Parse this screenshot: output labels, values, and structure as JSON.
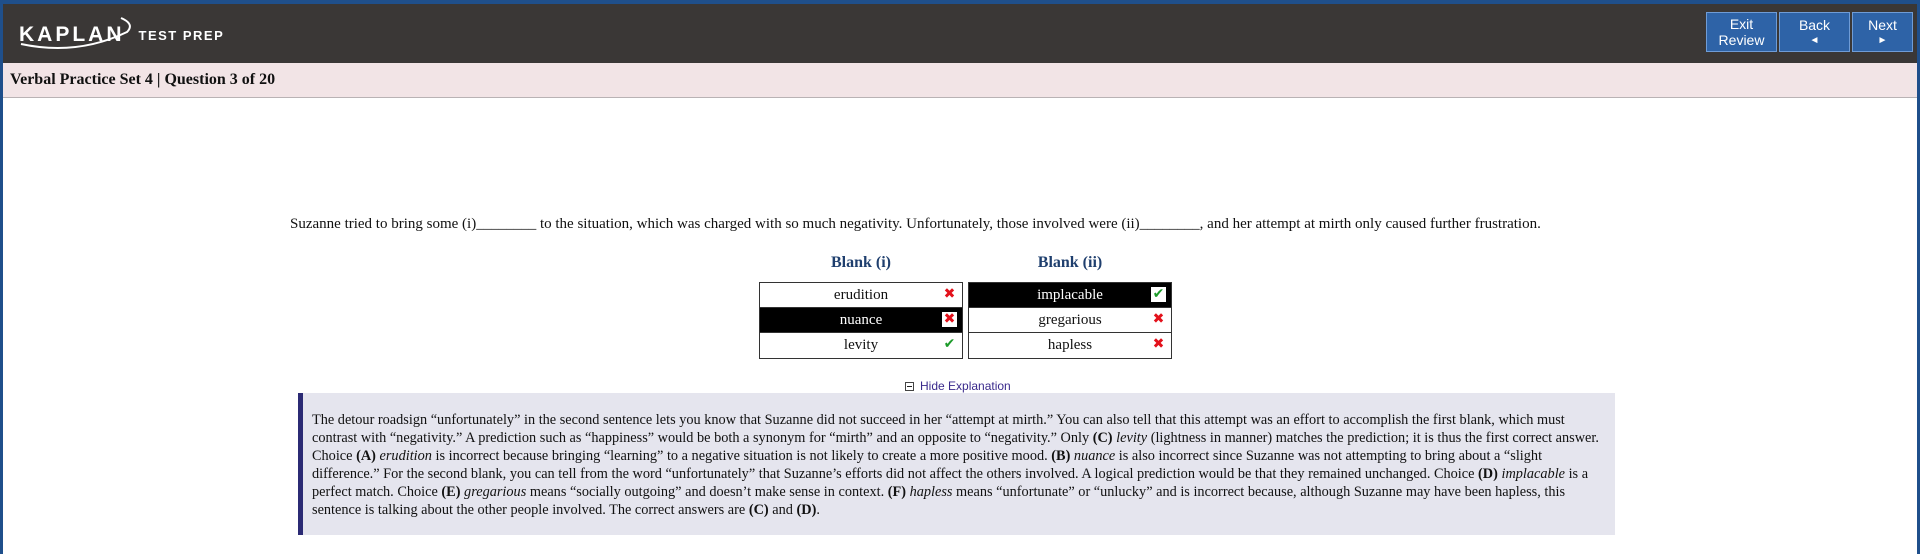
{
  "header": {
    "logo_main": "KAPLAN",
    "logo_sub": "TEST PREP",
    "buttons": [
      {
        "line1": "Exit",
        "line2": "Review"
      },
      {
        "line1": "Back",
        "line2": "◄"
      },
      {
        "line1": "Next",
        "line2": "►"
      }
    ]
  },
  "subheader": {
    "title": "Verbal Practice Set 4 | Question 3 of 20"
  },
  "question": {
    "text": "Suzanne tried to bring some (i)________ to the situation, which was charged with so much negativity. Unfortunately, those involved were (ii)________, and her attempt at mirth only caused further frustration."
  },
  "blanks": [
    {
      "heading": "Blank (i)",
      "options": [
        {
          "label": "erudition",
          "selected": false,
          "mark": "wrong"
        },
        {
          "label": "nuance",
          "selected": true,
          "mark": "wrong"
        },
        {
          "label": "levity",
          "selected": false,
          "mark": "right"
        }
      ]
    },
    {
      "heading": "Blank (ii)",
      "options": [
        {
          "label": "implacable",
          "selected": true,
          "mark": "right"
        },
        {
          "label": "gregarious",
          "selected": false,
          "mark": "wrong"
        },
        {
          "label": "hapless",
          "selected": false,
          "mark": "wrong"
        }
      ]
    }
  ],
  "explanation": {
    "toggle_label": "Hide Explanation",
    "segments": [
      {
        "t": "The detour roadsign “unfortunately” in the second sentence lets you know that Suzanne did not succeed in her “attempt at mirth.” You can also tell that this attempt was an effort to accomplish the first blank, which must contrast with “negativity.” A prediction such as “happiness” would be both a synonym for “mirth” and an opposite to “negativity.” Only "
      },
      {
        "t": "(C)",
        "s": "b"
      },
      {
        "t": " "
      },
      {
        "t": "levity",
        "s": "i"
      },
      {
        "t": " (lightness in manner) matches the prediction; it is thus the first correct answer. Choice "
      },
      {
        "t": "(A)",
        "s": "b"
      },
      {
        "t": " "
      },
      {
        "t": "erudition",
        "s": "i"
      },
      {
        "t": " is incorrect because bringing “learning” to a negative situation is not likely to create a more positive mood. "
      },
      {
        "t": "(B)",
        "s": "b"
      },
      {
        "t": " "
      },
      {
        "t": "nuance",
        "s": "i"
      },
      {
        "t": " is also incorrect since Suzanne was not attempting to bring about a “slight difference.” For the second blank, you can tell from the word “unfortunately” that Suzanne’s efforts did not affect the others involved. A logical prediction would be that they remained unchanged. Choice "
      },
      {
        "t": "(D)",
        "s": "b"
      },
      {
        "t": " "
      },
      {
        "t": "implacable",
        "s": "i"
      },
      {
        "t": " is a perfect match. Choice "
      },
      {
        "t": "(E)",
        "s": "b"
      },
      {
        "t": " "
      },
      {
        "t": "gregarious",
        "s": "i"
      },
      {
        "t": " means “socially outgoing” and doesn’t make sense in context. "
      },
      {
        "t": "(F)",
        "s": "b"
      },
      {
        "t": " "
      },
      {
        "t": "hapless",
        "s": "i"
      },
      {
        "t": " means “unfortunate” or “unlucky” and is incorrect because, although Suzanne may have been hapless, this sentence is talking about the other people involved. The correct answers are "
      },
      {
        "t": "(C)",
        "s": "b"
      },
      {
        "t": " and "
      },
      {
        "t": "(D)",
        "s": "b"
      },
      {
        "t": "."
      }
    ]
  },
  "colors": {
    "topbar": "#3a3736",
    "button": "#2e63a7",
    "subbar": "#f2e4e6",
    "explanation_bg": "#e5e5ee",
    "explanation_border": "#2b2a74",
    "correct": "#1d9b2a",
    "incorrect": "#e3111b"
  },
  "icons": {
    "correct": "check-icon",
    "incorrect": "x-icon",
    "toggle": "collapse-minus-icon"
  }
}
